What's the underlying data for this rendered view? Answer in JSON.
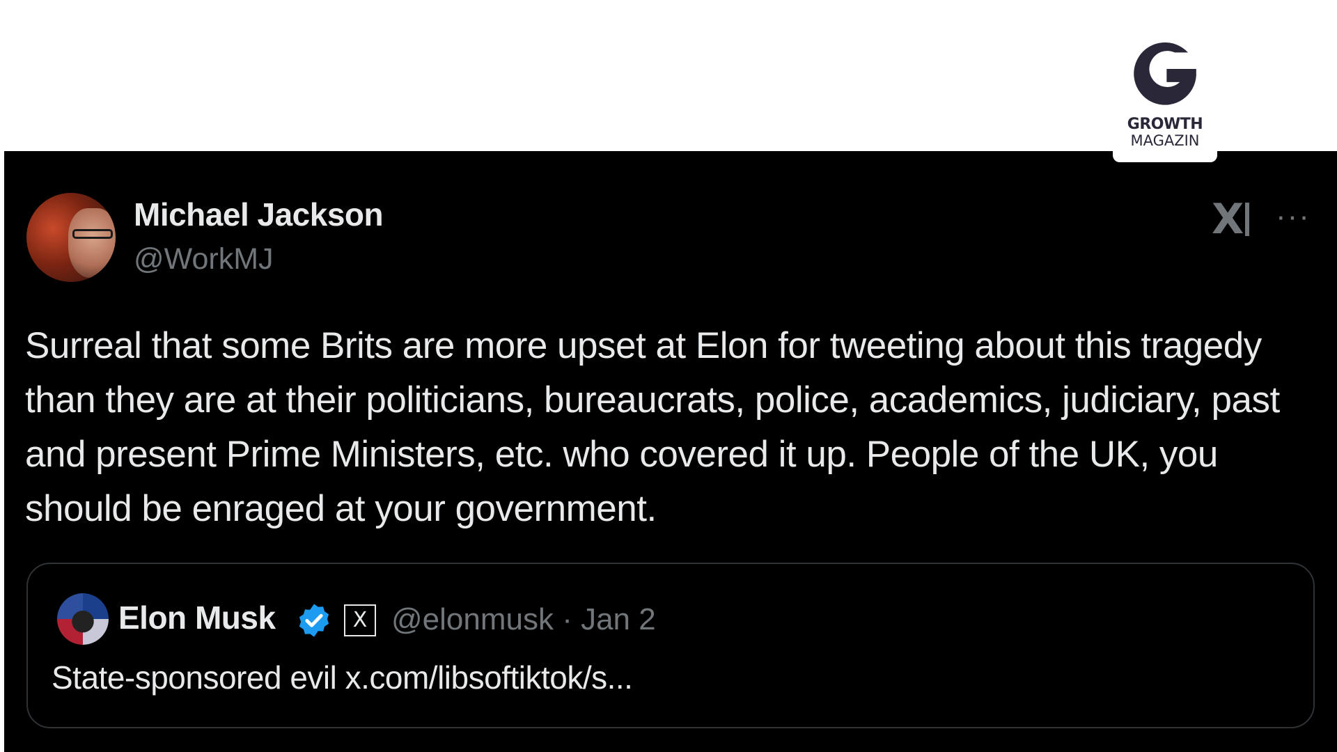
{
  "brand": {
    "word_top": "GROWTH",
    "word_bottom": "MAGAZIN",
    "color": "#2a2838"
  },
  "tweet": {
    "author_name": "Michael Jackson",
    "author_handle": "@WorkMJ",
    "x_logo": "X",
    "more": "···",
    "text": "Surreal that some Brits are more upset at Elon for tweeting about this tragedy than they are at their politicians, bureaucrats, police, academics, judiciary, past and present Prime Ministers, etc. who covered it up. People of the UK, you should be enraged at your government."
  },
  "quoted_tweet": {
    "author_name": "Elon Musk",
    "badge_glyph": "X",
    "handle_and_date": "@elonmusk · Jan 2",
    "text": "State-sponsored evil x.com/libsoftiktok/s..."
  },
  "colors": {
    "background": "#000000",
    "text_primary": "#e7e9ea",
    "text_secondary": "#71767b",
    "verified_blue": "#1d9bf0"
  },
  "icons": [
    "x-logo-icon",
    "more-options-icon",
    "verified-badge-icon",
    "x-affiliate-icon"
  ]
}
